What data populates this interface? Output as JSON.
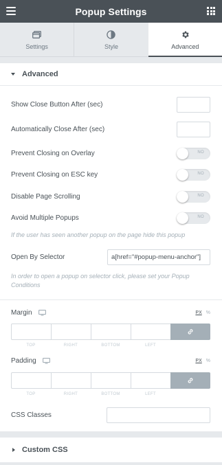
{
  "header": {
    "title": "Popup Settings",
    "menu_icon": "hamburger-icon",
    "apps_icon": "grid-icon",
    "bg_color": "#4a5157"
  },
  "tabs": [
    {
      "label": "Settings",
      "icon": "window-icon",
      "active": false
    },
    {
      "label": "Style",
      "icon": "half-circle-icon",
      "active": false
    },
    {
      "label": "Advanced",
      "icon": "gear-icon",
      "active": true
    }
  ],
  "advanced": {
    "title": "Advanced",
    "show_close_after": {
      "label": "Show Close Button After (sec)",
      "value": ""
    },
    "auto_close_after": {
      "label": "Automatically Close After (sec)",
      "value": ""
    },
    "prevent_overlay": {
      "label": "Prevent Closing on Overlay",
      "state": "NO"
    },
    "prevent_esc": {
      "label": "Prevent Closing on ESC key",
      "state": "NO"
    },
    "disable_scrolling": {
      "label": "Disable Page Scrolling",
      "state": "NO"
    },
    "avoid_multiple": {
      "label": "Avoid Multiple Popups",
      "state": "NO"
    },
    "avoid_multiple_desc": "If the user has seen another popup on the page hide this popup",
    "open_by_selector": {
      "label": "Open By Selector",
      "value": "a[href=\"#popup-menu-anchor\"]"
    },
    "open_by_selector_desc": "In order to open a popup on selector click, please set your Popup Conditions"
  },
  "margin": {
    "label": "Margin",
    "unit_px": "PX",
    "unit_pct": "%",
    "sides": [
      "TOP",
      "RIGHT",
      "BOTTOM",
      "LEFT"
    ]
  },
  "padding": {
    "label": "Padding",
    "unit_px": "PX",
    "unit_pct": "%",
    "sides": [
      "TOP",
      "RIGHT",
      "BOTTOM",
      "LEFT"
    ]
  },
  "css_classes": {
    "label": "CSS Classes",
    "value": ""
  },
  "custom_css": {
    "title": "Custom CSS"
  }
}
